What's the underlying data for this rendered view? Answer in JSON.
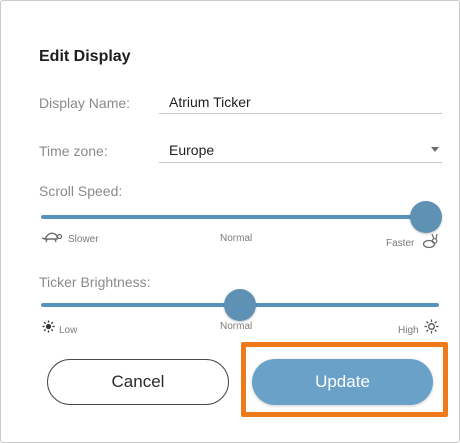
{
  "dialog": {
    "title": "Edit Display",
    "display_name": {
      "label": "Display Name:",
      "value": "Atrium Ticker"
    },
    "time_zone": {
      "label": "Time zone:",
      "value": "Europe"
    },
    "scroll_speed": {
      "label": "Scroll Speed:",
      "min_label": "Slower",
      "mid_label": "Normal",
      "max_label": "Faster",
      "value": 1.0,
      "min_icon": "turtle-icon",
      "max_icon": "rabbit-icon"
    },
    "ticker_brightness": {
      "label": "Ticker Brightness:",
      "min_label": "Low",
      "mid_label": "Normal",
      "max_label": "High",
      "value": 0.5,
      "min_icon": "sun-low-icon",
      "max_icon": "sun-high-icon"
    },
    "buttons": {
      "cancel": "Cancel",
      "update": "Update"
    }
  },
  "colors": {
    "accent": "#5692ba",
    "update_button": "#6aa1c8",
    "highlight_box": "#ef7a1a"
  }
}
